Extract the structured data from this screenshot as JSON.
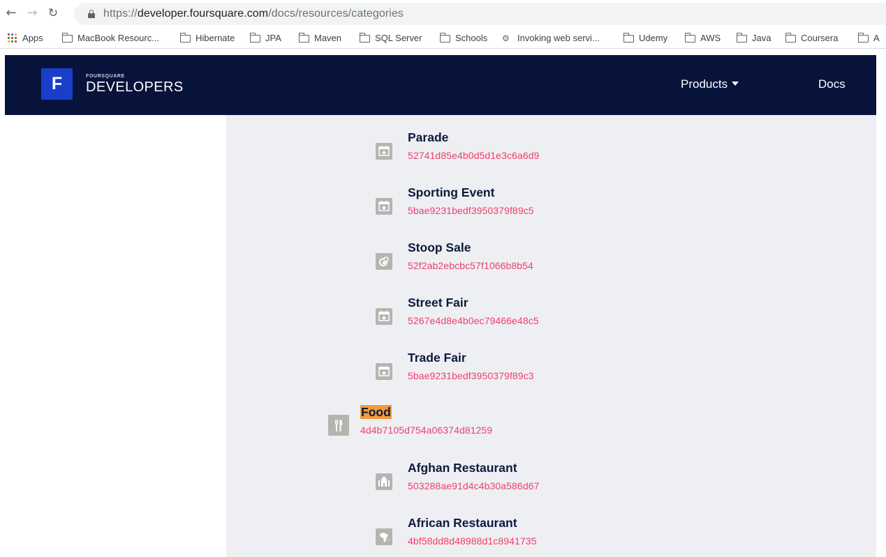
{
  "browser": {
    "url_scheme": "https://",
    "url_host": "developer.foursquare.com",
    "url_path": "/docs/resources/categories",
    "bookmarks": [
      {
        "label": "Apps",
        "icon": "apps-icon"
      },
      {
        "label": "MacBook Resourc...",
        "icon": "folder-icon"
      },
      {
        "label": "Hibernate",
        "icon": "folder-icon"
      },
      {
        "label": "JPA",
        "icon": "folder-icon"
      },
      {
        "label": "Maven",
        "icon": "folder-icon"
      },
      {
        "label": "SQL Server",
        "icon": "folder-icon"
      },
      {
        "label": "Schools",
        "icon": "folder-icon"
      },
      {
        "label": "Invoking web servi...",
        "icon": "gear-icon"
      },
      {
        "label": "Udemy",
        "icon": "folder-icon"
      },
      {
        "label": "AWS",
        "icon": "folder-icon"
      },
      {
        "label": "Java",
        "icon": "folder-icon"
      },
      {
        "label": "Coursera",
        "icon": "folder-icon"
      },
      {
        "label": "A",
        "icon": "folder-icon"
      }
    ]
  },
  "header": {
    "logo_letter": "F",
    "brand_small": "FOURSQUARE",
    "brand_big": "DEVELOPERS",
    "nav_products": "Products",
    "nav_docs": "Docs",
    "background": "#07133b"
  },
  "categories": [
    {
      "name": "Parade",
      "id": "52741d85e4b0d5d1e3c6a6d9",
      "icon": "calendar-star-icon"
    },
    {
      "name": "Sporting Event",
      "id": "5bae9231bedf3950379f89c5",
      "icon": "calendar-star-icon"
    },
    {
      "name": "Stoop Sale",
      "id": "52f2ab2ebcbc57f1066b8b54",
      "icon": "sale-tag-icon"
    },
    {
      "name": "Street Fair",
      "id": "5267e4d8e4b0ec79466e48c5",
      "icon": "calendar-star-icon"
    },
    {
      "name": "Trade Fair",
      "id": "5bae9231bedf3950379f89c3",
      "icon": "calendar-star-icon"
    },
    {
      "name": "Food",
      "id": "4d4b7105d754a06374d81259",
      "icon": "fork-knife-icon",
      "highlighted": true
    },
    {
      "name": "Afghan Restaurant",
      "id": "503288ae91d4c4b30a586d67",
      "icon": "mosque-icon"
    },
    {
      "name": "African Restaurant",
      "id": "4bf58dd8d48988d1c8941735",
      "icon": "africa-icon"
    }
  ],
  "colors": {
    "category_id": "#ef3e6f",
    "category_name": "#0c1a3c",
    "highlight": "#f29a3a",
    "icon_tile": "#b4b4b0"
  }
}
